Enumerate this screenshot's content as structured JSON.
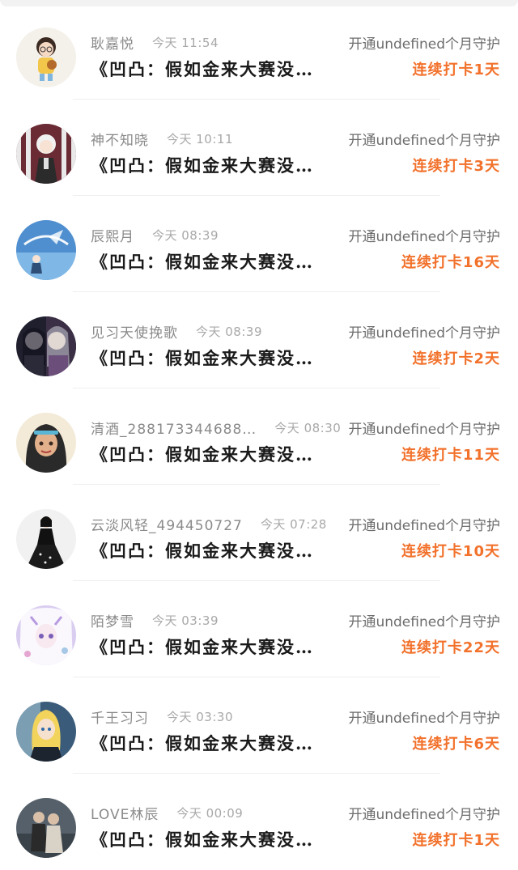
{
  "rows": [
    {
      "name": "耿嘉悦",
      "time": "今天 11:54",
      "guard": "开通undefined个月守护",
      "content": "《凹凸：假如金来大赛没…",
      "checkin": "连续打卡1天",
      "avatar_bg": "#f4f1ea",
      "avatar_fg": "#d99a3c",
      "avatar_icon": "cartoon-girl-avatar"
    },
    {
      "name": "神不知晓",
      "time": "今天 10:11",
      "guard": "开通undefined个月守护",
      "content": "《凹凸：假如金来大赛没…",
      "checkin": "连续打卡3天",
      "avatar_bg": "#6a2b35",
      "avatar_fg": "#e9e9e9",
      "avatar_icon": "anime-boy-avatar"
    },
    {
      "name": "辰熙月",
      "time": "今天 08:39",
      "guard": "开通undefined个月守护",
      "content": "《凹凸：假如金来大赛没…",
      "checkin": "连续打卡16天",
      "avatar_bg": "#4f8fcf",
      "avatar_fg": "#f3f7fb",
      "avatar_icon": "anime-scene-avatar"
    },
    {
      "name": "见习天使挽歌",
      "time": "今天 08:39",
      "guard": "开通undefined个月守护",
      "content": "《凹凸：假如金来大赛没…",
      "checkin": "连续打卡2天",
      "avatar_bg": "#1f1f2e",
      "avatar_fg": "#f0e6ef",
      "avatar_icon": "anime-girls-avatar"
    },
    {
      "name": "清酒_288173344688…",
      "time": "今天 08:30",
      "guard": "开通undefined个月守护",
      "content": "《凹凸：假如金来大赛没…",
      "checkin": "连续打卡11天",
      "avatar_bg": "#f3ead8",
      "avatar_fg": "#2a2a2a",
      "avatar_icon": "princess-avatar"
    },
    {
      "name": "云淡风轻_494450727",
      "time": "今天 07:28",
      "guard": "开通undefined个月守护",
      "content": "《凹凸：假如金来大赛没…",
      "checkin": "连续打卡10天",
      "avatar_bg": "#f1f1f1",
      "avatar_fg": "#111111",
      "avatar_icon": "black-dress-avatar"
    },
    {
      "name": "陌梦雪",
      "time": "今天 03:39",
      "guard": "开通undefined个月守护",
      "content": "《凹凸：假如金来大赛没…",
      "checkin": "连续打卡22天",
      "avatar_bg": "#d9cdf0",
      "avatar_fg": "#ffffff",
      "avatar_icon": "anime-fairy-avatar"
    },
    {
      "name": "千王习习",
      "time": "今天 03:30",
      "guard": "开通undefined个月守护",
      "content": "《凹凸：假如金来大赛没…",
      "checkin": "连续打卡6天",
      "avatar_bg": "#3a5c7a",
      "avatar_fg": "#f2d35c",
      "avatar_icon": "blonde-anime-avatar"
    },
    {
      "name": "LOVE林辰",
      "time": "今天 00:09",
      "guard": "开通undefined个月守护",
      "content": "《凹凸：假如金来大赛没…",
      "checkin": "连续打卡1天",
      "avatar_bg": "#55606a",
      "avatar_fg": "#d9d2c7",
      "avatar_icon": "couple-photo-avatar"
    }
  ]
}
